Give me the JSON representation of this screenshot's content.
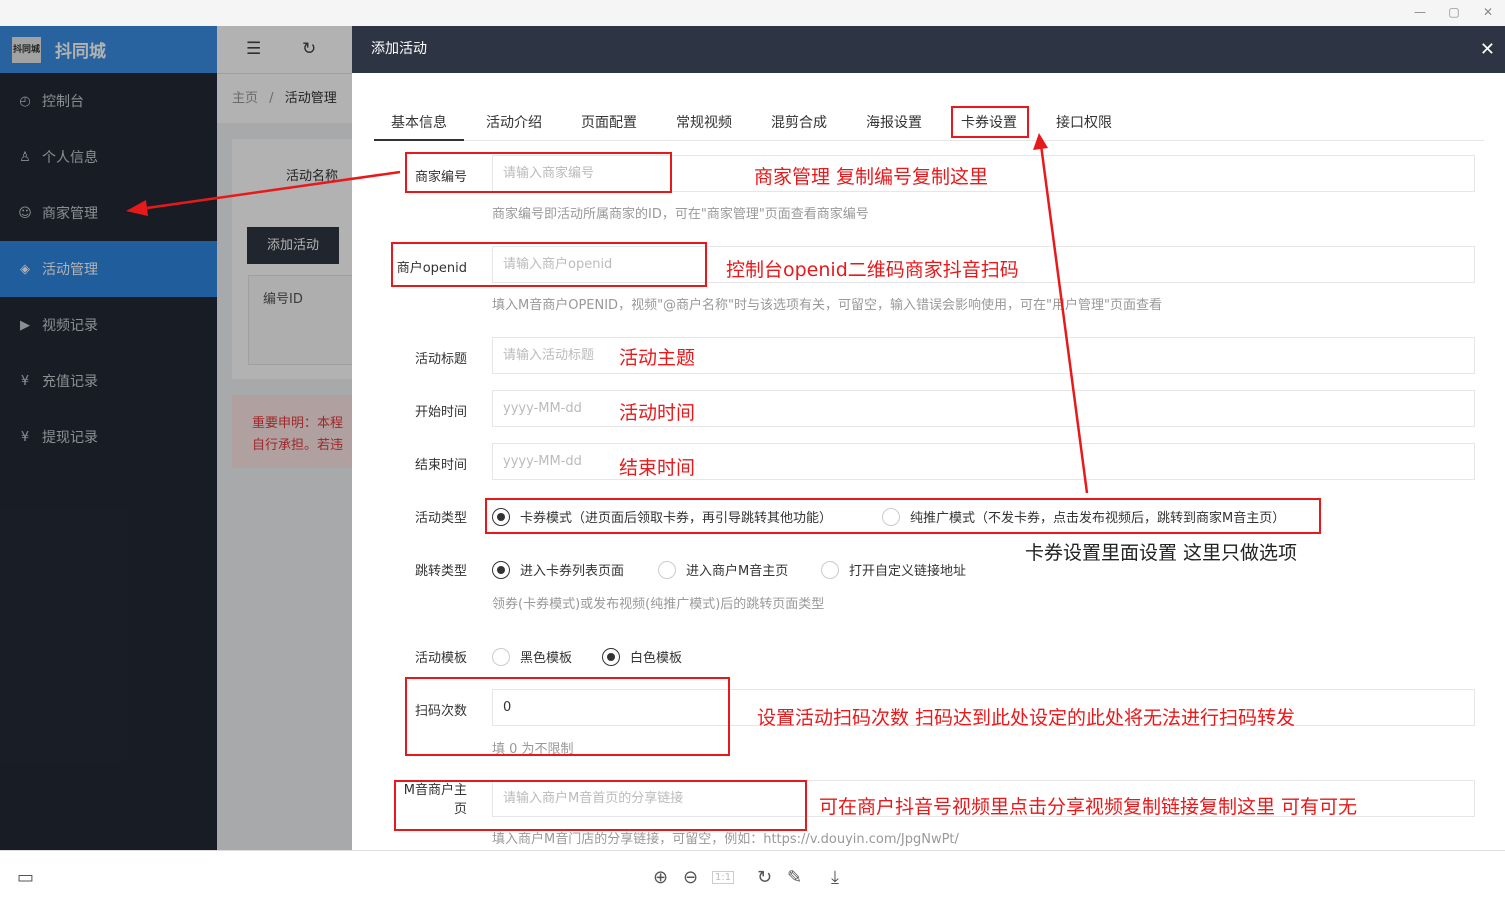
{
  "window": {
    "minimize": "—",
    "maximize": "▢",
    "close": "✕"
  },
  "sidebar": {
    "logo_badge": "抖同城",
    "logo_text": "抖同城",
    "items": [
      {
        "label": "控制台",
        "icon": "◴"
      },
      {
        "label": "个人信息",
        "icon": "♙"
      },
      {
        "label": "商家管理",
        "icon": "☺"
      },
      {
        "label": "活动管理",
        "icon": "◈"
      },
      {
        "label": "视频记录",
        "icon": "▶"
      },
      {
        "label": "充值记录",
        "icon": "¥"
      },
      {
        "label": "提现记录",
        "icon": "¥"
      }
    ]
  },
  "topbar": {
    "menu_icon": "☰",
    "refresh_icon": "↻"
  },
  "breadcrumb": {
    "home": "主页",
    "sep": "/",
    "current": "活动管理"
  },
  "background": {
    "filter_label": "活动名称",
    "add_button": "添加活动",
    "table_header": "编号ID",
    "warning_line1": "重要申明：本程",
    "warning_line2": "自行承担。若违"
  },
  "modal": {
    "title": "添加活动",
    "close": "✕",
    "tabs": [
      "基本信息",
      "活动介绍",
      "页面配置",
      "常规视频",
      "混剪合成",
      "海报设置",
      "卡券设置",
      "接口权限"
    ],
    "fields": {
      "merchant_no": {
        "label": "商家编号",
        "placeholder": "请输入商家编号",
        "hint": "商家编号即活动所属商家的ID，可在\"商家管理\"页面查看商家编号"
      },
      "openid": {
        "label": "商户openid",
        "placeholder": "请输入商户openid",
        "hint": "填入M音商户OPENID，视频\"@商户名称\"时与该选项有关，可留空，输入错误会影响使用，可在\"用户管理\"页面查看"
      },
      "title": {
        "label": "活动标题",
        "placeholder": "请输入活动标题"
      },
      "start": {
        "label": "开始时间",
        "placeholder": "yyyy-MM-dd"
      },
      "end": {
        "label": "结束时间",
        "placeholder": "yyyy-MM-dd"
      },
      "type": {
        "label": "活动类型",
        "options": [
          "卡券模式（进页面后领取卡券，再引导跳转其他功能）",
          "纯推广模式（不发卡券，点击发布视频后，跳转到商家M音主页）"
        ],
        "selected": 0
      },
      "jump": {
        "label": "跳转类型",
        "options": [
          "进入卡券列表页面",
          "进入商户M音主页",
          "打开自定义链接地址"
        ],
        "selected": 0,
        "hint": "领券(卡券模式)或发布视频(纯推广模式)后的跳转页面类型"
      },
      "template": {
        "label": "活动模板",
        "options": [
          "黑色模板",
          "白色模板"
        ],
        "selected": 1
      },
      "scan": {
        "label": "扫码次数",
        "value": "0",
        "hint": "填 0 为不限制"
      },
      "homepage": {
        "label_line1": "M音商户主",
        "label_line2": "页",
        "placeholder": "请输入商户M音首页的分享链接",
        "hint": "填入商户M音门店的分享链接，可留空，例如：https://v.douyin.com/JpgNwPt/"
      }
    }
  },
  "annotations": {
    "merchant": "商家管理 复制编号复制这里",
    "openid": "控制台openid二维码商家抖音扫码",
    "title": "活动主题",
    "start": "活动时间",
    "end": "结束时间",
    "coupon": "卡券设置里面设置   这里只做选项",
    "scan": "设置活动扫码次数   扫码达到此处设定的此处将无法进行扫码转发",
    "homepage": "可在商户抖音号视频里点击分享视频复制链接复制这里   可有可无",
    "color": "#e8191b"
  },
  "bottombar": {
    "panel_icon": "▭",
    "zoom_in": "⊕",
    "zoom_out": "⊖",
    "fit": "1:1",
    "rotate": "↻",
    "edit": "✎",
    "download": "⤓"
  }
}
